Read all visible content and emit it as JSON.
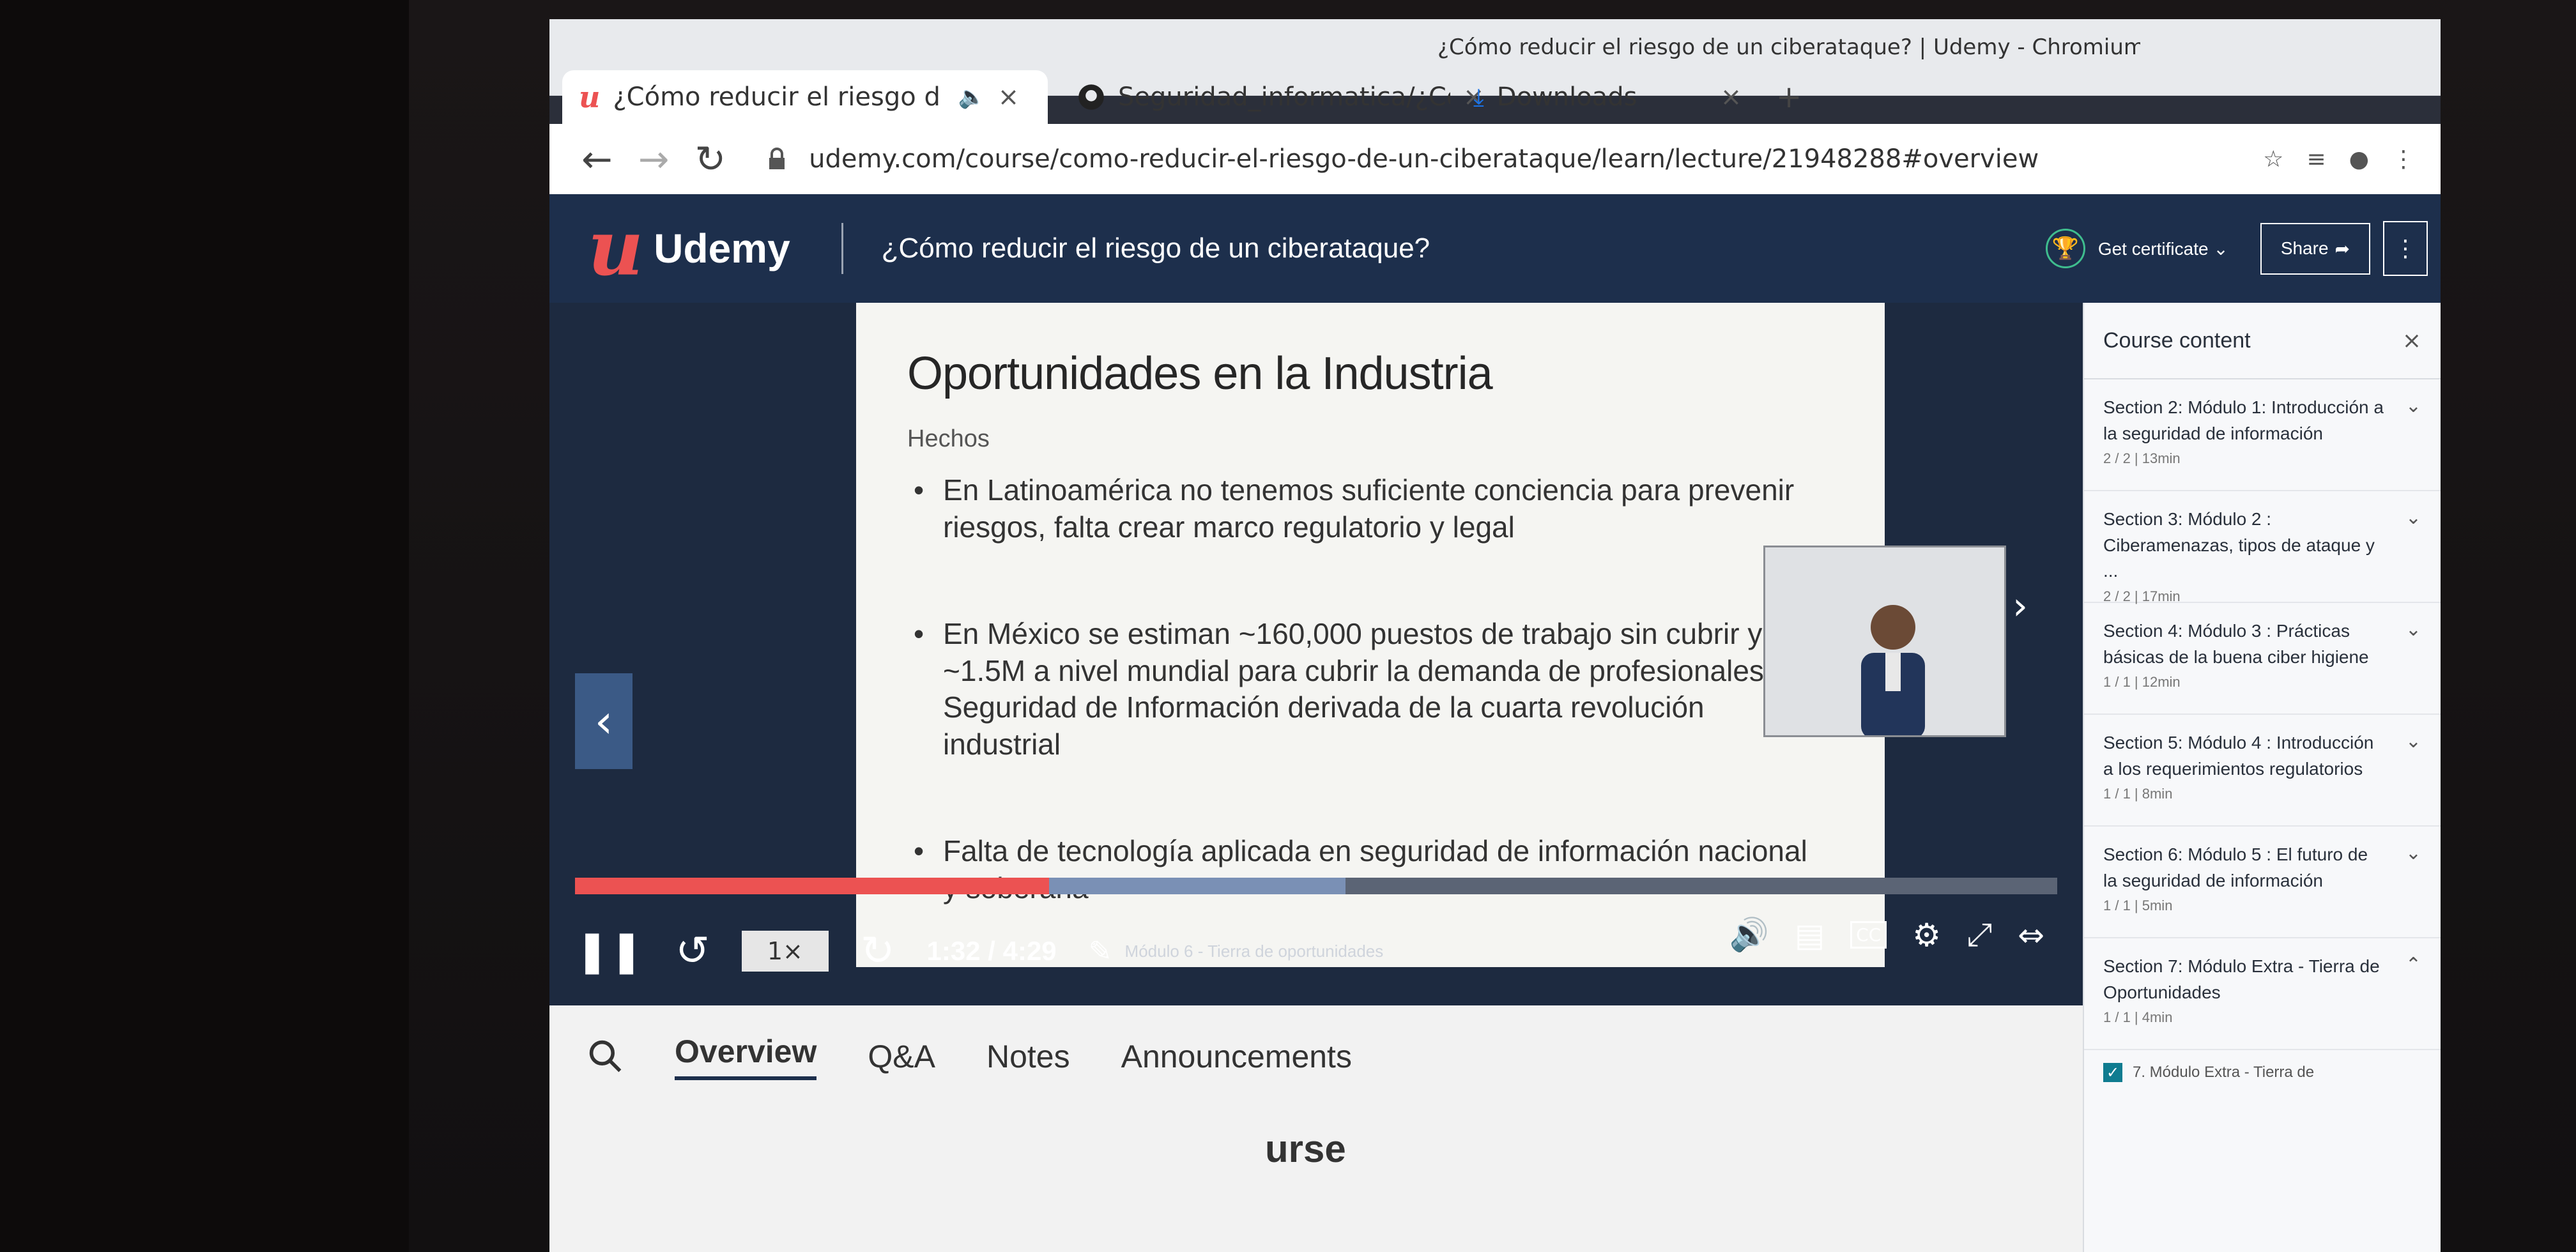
{
  "browser": {
    "window_title": "¿Cómo reducir el riesgo de un ciberataque? | Udemy - Chromium",
    "tabs": [
      {
        "label": "¿Cómo reducir el riesgo d",
        "active": true
      },
      {
        "label": "Seguridad_informatica/¿Cóm",
        "active": false
      },
      {
        "label": "Downloads",
        "active": false
      }
    ],
    "url": "udemy.com/course/como-reducir-el-riesgo-de-un-ciberataque/learn/lecture/21948288#overview"
  },
  "header": {
    "logo_mark": "u",
    "logo_text": "Udemy",
    "course_title": "¿Cómo reducir el riesgo de un ciberataque?",
    "get_certificate": "Get certificate",
    "share": "Share"
  },
  "slide": {
    "title": "Oportunidades en la Industria",
    "subtitle": "Hechos",
    "bullets": [
      "En Latinoamérica no tenemos suficiente conciencia para prevenir riesgos, falta crear marco regulatorio y legal",
      "En México se estiman ~160,000 puestos de trabajo sin cubrir y ~1.5M a nivel mundial para cubrir la demanda de profesionales en Seguridad de Información derivada de la cuarta revolución industrial",
      "Falta de tecnología aplicada en seguridad de información nacional y soberana"
    ]
  },
  "player": {
    "rate": "1×",
    "time": "1:32 / 4:29",
    "chapter": "Módulo 6 - Tierra de oportunidades",
    "progress_played": 0.32,
    "progress_buffered": 0.52
  },
  "lower_tabs": {
    "items": [
      "Overview",
      "Q&A",
      "Notes",
      "Announcements"
    ],
    "heading_fragment": "urse"
  },
  "sidebar": {
    "title": "Course content",
    "sections": [
      {
        "title": "Section 2: Módulo 1: Introducción a la seguridad de información",
        "meta": "2 / 2 | 13min"
      },
      {
        "title": "Section 3: Módulo 2 : Ciberamenazas, tipos de ataque y ...",
        "meta": "2 / 2 | 17min"
      },
      {
        "title": "Section 4: Módulo 3 : Prácticas básicas de la buena ciber higiene",
        "meta": "1 / 1 | 12min"
      },
      {
        "title": "Section 5: Módulo 4 : Introducción a los requerimientos regulatorios",
        "meta": "1 / 1 | 8min"
      },
      {
        "title": "Section 6: Módulo 5 : El futuro de la seguridad de información",
        "meta": "1 / 1 | 5min"
      },
      {
        "title": "Section 7: Módulo Extra - Tierra de Oportunidades",
        "meta": "1 / 1 | 4min"
      }
    ],
    "lecture": "7. Módulo Extra - Tierra de"
  },
  "colors": {
    "udemy_navy": "#1d2f4c",
    "udemy_red": "#ec5252",
    "certificate_green": "#3fbd8e"
  }
}
